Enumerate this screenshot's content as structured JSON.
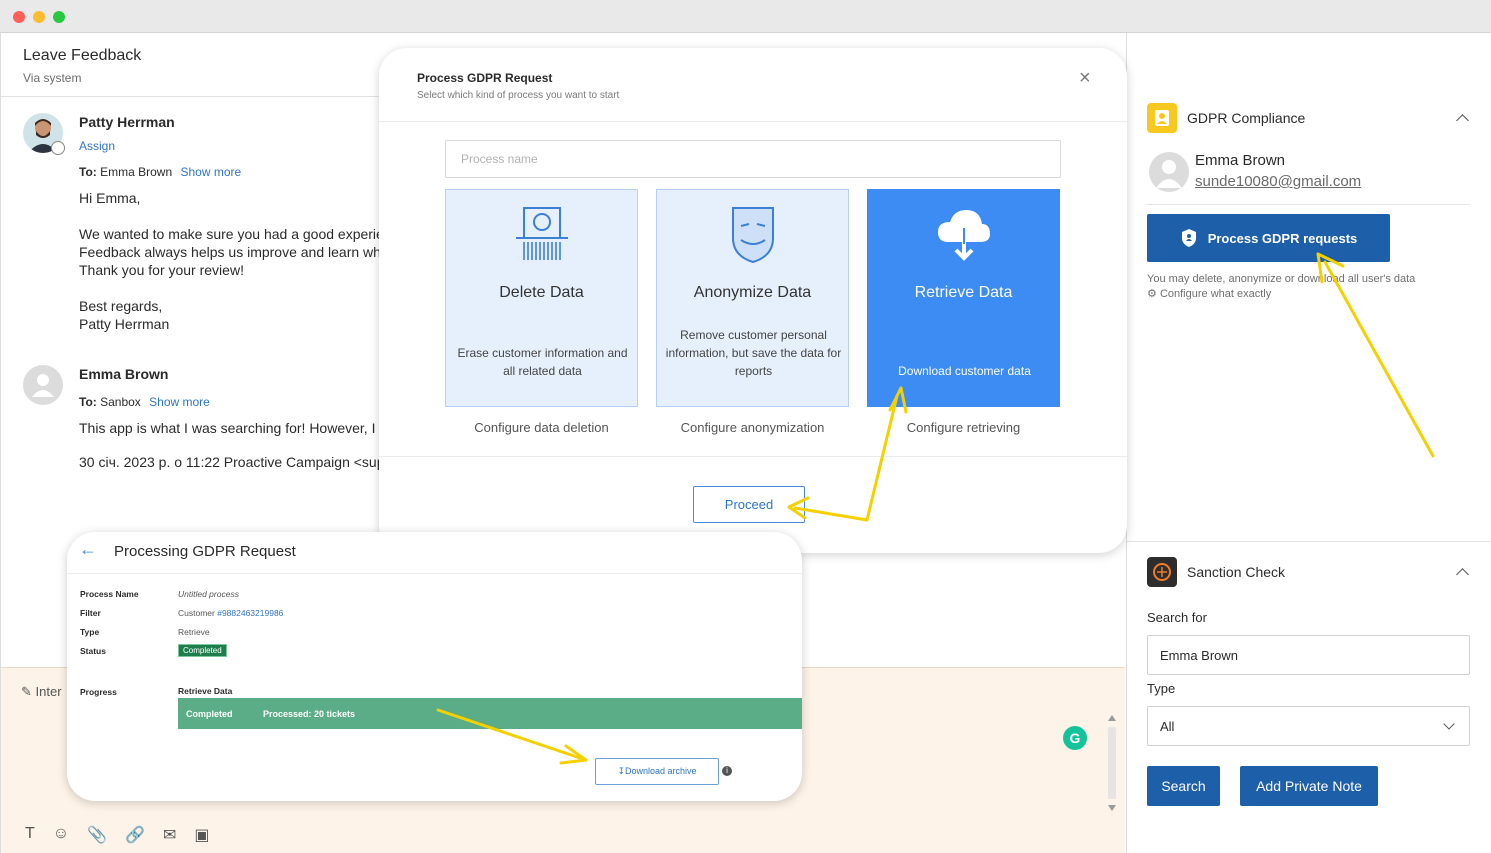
{
  "ticket": {
    "title": "Leave Feedback",
    "subtitle": "Via system",
    "messages": [
      {
        "author": "Patty Herrman",
        "assign": "Assign",
        "to_prefix": "To:",
        "to": "Emma Brown",
        "show_more": "Show more",
        "lines": [
          "Hi Emma,",
          "We wanted to make sure you had a good experie",
          "Feedback always helps us improve and learn whe",
          "Thank you for your review!",
          "Best regards,",
          "Patty Herrman"
        ]
      },
      {
        "author": "Emma Brown",
        "to_prefix": "To:",
        "to": "Sanbox",
        "show_more": "Show more",
        "lines": [
          "This app is what I was searching for! However, I w",
          "30 січ. 2023 р. о 11:22 Proactive Campaign <sup"
        ]
      }
    ],
    "composer_label": "Inter"
  },
  "modal": {
    "title": "Process GDPR Request",
    "subtitle": "Select which kind of process you want to start",
    "process_name_placeholder": "Process name",
    "cards": [
      {
        "title": "Delete Data",
        "desc": "Erase customer information and all related data",
        "config": "Configure data deletion",
        "icon": "barcode-face-icon"
      },
      {
        "title": "Anonymize Data",
        "desc": "Remove customer personal information, but save the data for reports",
        "config": "Configure anonymization",
        "icon": "mask-icon"
      },
      {
        "title": "Retrieve Data",
        "desc": "Download customer data",
        "config": "Configure retrieving",
        "icon": "cloud-download-icon"
      }
    ],
    "proceed": "Proceed"
  },
  "processing": {
    "title": "Processing GDPR Request",
    "fields": {
      "process_name_k": "Process Name",
      "process_name_v": "Untitled process",
      "filter_k": "Filter",
      "filter_v": "Customer",
      "filter_link": "#9882463219986",
      "type_k": "Type",
      "type_v": "Retrieve",
      "status_k": "Status",
      "status_v": "Completed",
      "progress_k": "Progress",
      "progress_label": "Retrieve Data"
    },
    "progress": {
      "status": "Completed",
      "processed": "Processed: 20 tickets",
      "fraction": 1.0
    },
    "download": "Download archive"
  },
  "sidebar": {
    "gdpr": {
      "title": "GDPR Compliance",
      "user_name": "Emma Brown",
      "user_email": "sunde10080@gmail.com",
      "button": "Process GDPR requests",
      "note": "You may delete, anonymize or download all user's data",
      "configure": "Configure what exactly"
    },
    "sanction": {
      "title": "Sanction Check",
      "search_label": "Search for",
      "search_value": "Emma Brown",
      "type_label": "Type",
      "type_value": "All",
      "search_button": "Search",
      "note_button": "Add Private Note"
    }
  },
  "colors": {
    "primary": "#1d5fa8",
    "card_active": "#3c8cf3",
    "card_bg": "#e6f0fc",
    "progress": "#5aad87",
    "badge": "#1e7d4d",
    "annotation_arrow": "#f5d000"
  }
}
